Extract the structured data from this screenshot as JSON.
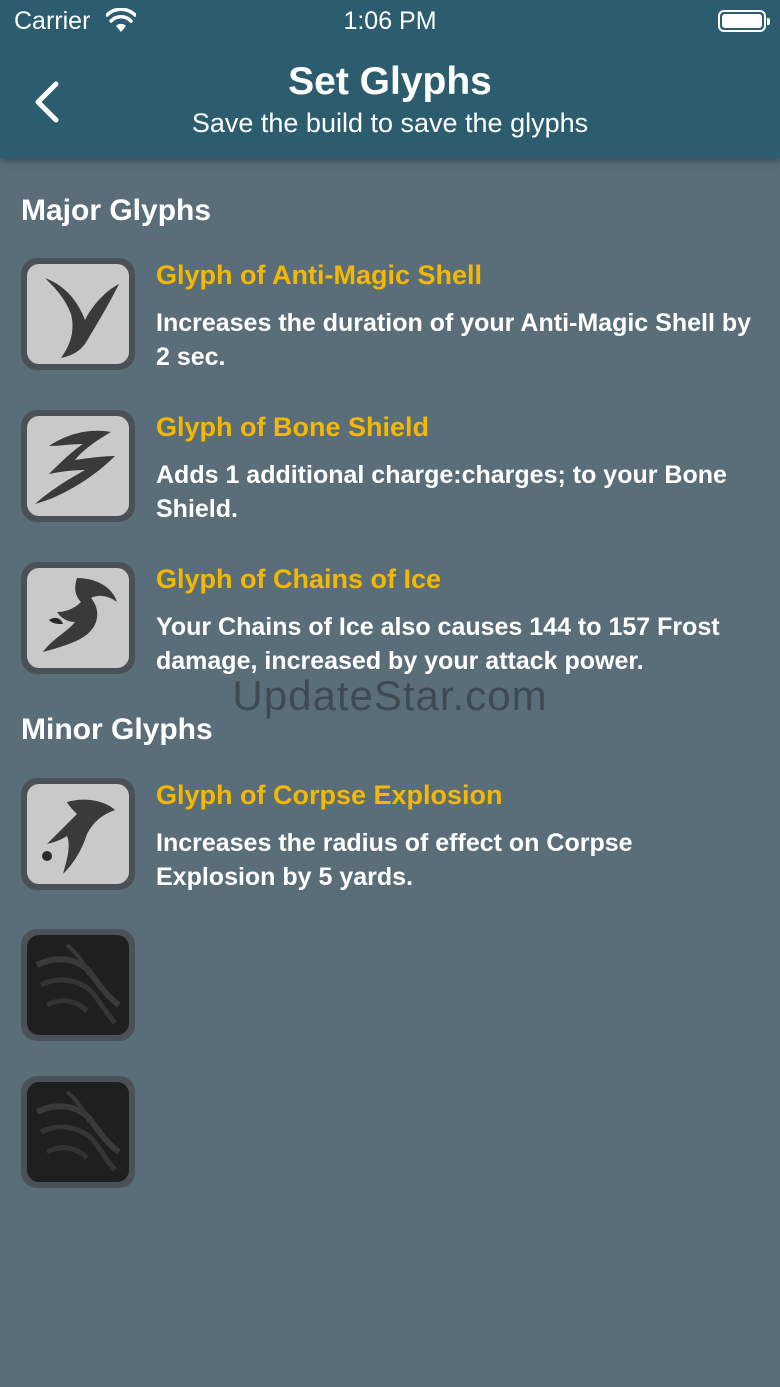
{
  "status_bar": {
    "carrier": "Carrier",
    "time": "1:06 PM"
  },
  "header": {
    "title": "Set Glyphs",
    "subtitle": "Save the build to save the glyphs",
    "back_icon": "chevron-left-icon"
  },
  "sections": {
    "major": {
      "title": "Major Glyphs",
      "items": [
        {
          "name": "Glyph of Anti-Magic Shell",
          "description": "Increases the duration of your Anti-Magic Shell by 2 sec."
        },
        {
          "name": "Glyph of Bone Shield",
          "description": "Adds 1 additional charge:charges; to your Bone Shield."
        },
        {
          "name": "Glyph of Chains of Ice",
          "description": "Your Chains of Ice also causes 144 to 157 Frost damage, increased by your attack power."
        }
      ]
    },
    "minor": {
      "title": "Minor Glyphs",
      "items": [
        {
          "name": "Glyph of Corpse Explosion",
          "description": "Increases the radius of effect on Corpse Explosion by 5 yards."
        }
      ]
    }
  },
  "watermark": "UpdateStar.com",
  "colors": {
    "header_bg": "#2c5d6f",
    "page_bg": "#5a6e7a",
    "glyph_name": "#f5b800"
  }
}
